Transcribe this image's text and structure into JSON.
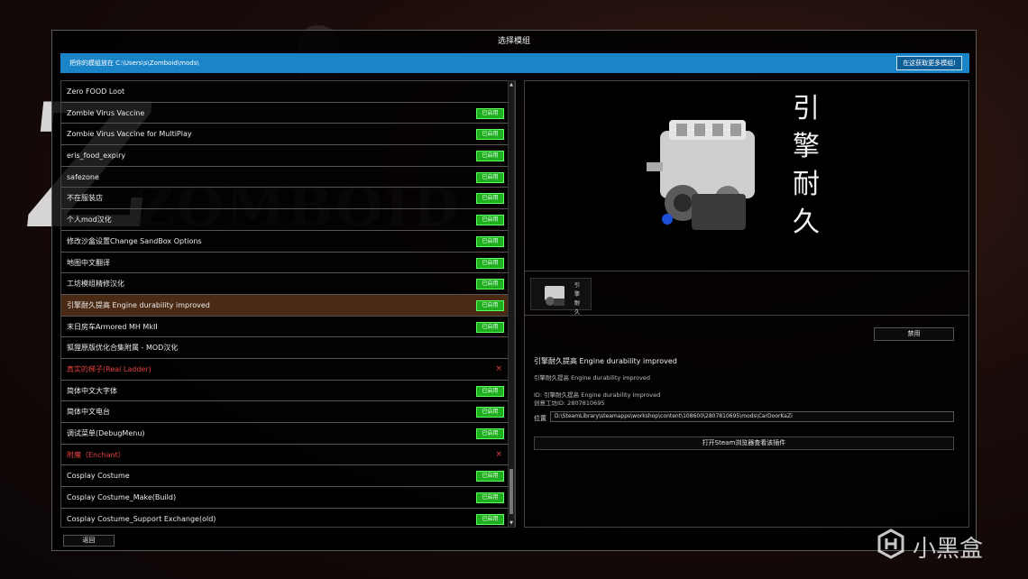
{
  "background": {
    "logo_word": "ZOMBOID"
  },
  "dialog": {
    "title": "选择模组",
    "info_path": "把你的模组放在 C:\\Users\\s\\Zomboid\\mods\\",
    "get_more_button": "在这获取更多模组!"
  },
  "mods": [
    {
      "name": "Zero FOOD Loot",
      "state": "none"
    },
    {
      "name": "Zombie Virus Vaccine",
      "state": "enabled"
    },
    {
      "name": "Zombie Virus Vaccine for MultiPlay",
      "state": "enabled"
    },
    {
      "name": "eris_food_expiry",
      "state": "enabled"
    },
    {
      "name": "safezone",
      "state": "enabled"
    },
    {
      "name": "不在服装店",
      "state": "enabled"
    },
    {
      "name": "个人mod汉化",
      "state": "enabled"
    },
    {
      "name": "修改沙盒设置Change SandBox Options",
      "state": "enabled"
    },
    {
      "name": "地图中文翻译",
      "state": "enabled"
    },
    {
      "name": "工坊模组精修汉化",
      "state": "enabled"
    },
    {
      "name": "引擎耐久提高 Engine durability improved",
      "state": "enabled",
      "selected": true
    },
    {
      "name": "末日房车Armored MH MkII",
      "state": "enabled"
    },
    {
      "name": "狐狸原版优化合集附属 - MOD汉化",
      "state": "none"
    },
    {
      "name": "真实的梯子(Real Ladder)",
      "state": "broken"
    },
    {
      "name": "简体中文大字体",
      "state": "enabled"
    },
    {
      "name": "简体中文电台",
      "state": "enabled"
    },
    {
      "name": "调试菜单(DebugMenu)",
      "state": "enabled"
    },
    {
      "name": "附魔（Enchant）",
      "state": "broken"
    },
    {
      "name": "Cosplay Costume",
      "state": "enabled"
    },
    {
      "name": "Cosplay Costume_Make(Build)",
      "state": "enabled"
    },
    {
      "name": "Cosplay Costume_Support Exchange(old)",
      "state": "enabled"
    }
  ],
  "labels": {
    "enabled_badge": "已启用",
    "broken_mark": "×",
    "back_button": "返回",
    "disable_button": "禁用",
    "location_label": "位置",
    "open_steam_button": "打开Steam浏览器查看该插件"
  },
  "preview": {
    "text": [
      "引",
      "擎",
      "耐",
      "久"
    ]
  },
  "detail": {
    "title": "引擎耐久提高 Engine durability improved",
    "description": "引擎耐久提高 Engine durability improved",
    "id_line": "ID: 引擎耐久提高 Engine durability improved",
    "workshop_line": "创意工坊ID: 2807810695",
    "location": "D:\\SteamLibrary\\steamapps\\workshop\\content\\108600\\2807810695\\mods\\CarDoorKaZi"
  },
  "watermark": {
    "text": "小黑盒"
  },
  "colors": {
    "info_bar": "#1a84c8",
    "enabled_badge": "#1fae1f",
    "selected_row": "#4a2a14",
    "broken_text": "#e04040"
  }
}
